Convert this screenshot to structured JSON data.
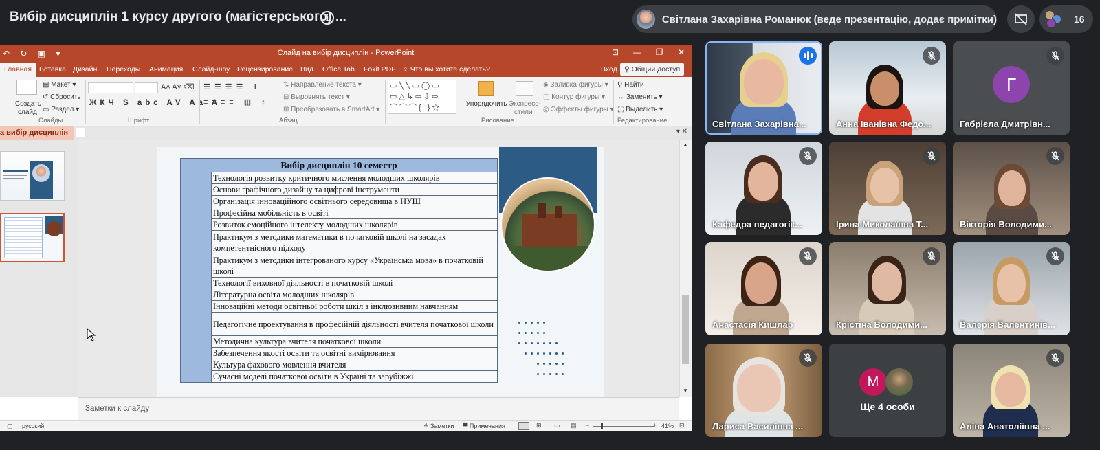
{
  "meeting": {
    "title": "Вибір дисциплін 1 курсу другого (магістерського) ...",
    "presenter_label": "Світлана Захарівна Романюк (веде презентацію, додає примітки)",
    "participant_count": "16"
  },
  "ppt": {
    "window_title": "Слайд на вибір дисциплін - PowerPoint",
    "tabs": [
      "Главная",
      "Вставка",
      "Дизайн",
      "Переходы",
      "Анимация",
      "Слайд-шоу",
      "Рецензирование",
      "Вид",
      "Office Tab",
      "Foxit PDF",
      "Что вы хотите сделать?"
    ],
    "login": "Вход",
    "share": "Общий доступ",
    "ribbon": {
      "create_slide": "Создать",
      "slide_label": "слайд",
      "layout": "Макет",
      "reset": "Сбросить",
      "section": "Раздел",
      "group_slides": "Слайды",
      "group_font": "Шрифт",
      "group_paragraph": "Абзац",
      "group_drawing": "Рисование",
      "group_editing": "Редактирование",
      "text_direction": "Направление текста",
      "align_text": "Выровнять текст",
      "smartart": "Преобразовать в SmartArt",
      "arrange": "Упорядочить",
      "quick_styles": "Экспресс-",
      "quick_styles_2": "стили",
      "shape_fill": "Заливка фигуры",
      "shape_outline": "Контур фигуры",
      "shape_effects": "Эффекты фигуры",
      "find": "Найти",
      "replace": "Заменить",
      "select": "Выделить"
    },
    "doc_tab": "а вибір дисциплін",
    "notes_placeholder": "Заметки к слайду",
    "status": {
      "language": "русский",
      "notes": "Заметки",
      "comments": "Примечания",
      "zoom": "41%"
    },
    "thumb1_name": "Світлана ... Романюк"
  },
  "slide": {
    "table_title": "Вибір дисциплін 10 семестр",
    "items": [
      "Технологія розвитку критичного мислення молодших школярів",
      "Основи графічного дизайну та цифрові інструменти",
      "Організація інноваційного освітнього середовища в НУШ",
      "Професійна мобільність в освіті",
      "Розвиток емоційного інтелекту молодших школярів",
      "Практикум з методики математики в початковій школі на засадах компетентнісного підходу",
      "Практикум з методики інтегрованого курсу «Українська мова» в початковій школі",
      "Технології виховної діяльності в початковій школі",
      "Літературна освіта молодших школярів",
      "Інноваційні методи освітньої роботи шкіл з інклюзивним навчанням",
      "Педагогічне проектування в професійній діяльності вчителя початкової школи",
      "Методична культура вчителя початкової школи",
      "Забезпечення якості освіти та освітні вимірювання",
      "Культура фахового мовлення вчителя",
      "Сучасні моделі початкової освіти в Україні та зарубіжжі"
    ]
  },
  "participants": [
    {
      "name": "Світлана Захарівна...",
      "speaking": true
    },
    {
      "name": "Анна Іванівна Федо...",
      "muted": true
    },
    {
      "name": "Габрієла Дмитрівн...",
      "muted": true,
      "initial": "Г"
    },
    {
      "name": "Кафедра педагогік...",
      "muted": true
    },
    {
      "name": "Ірина Миколаївна Т...",
      "muted": true
    },
    {
      "name": "Вікторія Володими...",
      "muted": true
    },
    {
      "name": "Анастасія Кишлар",
      "muted": true
    },
    {
      "name": "Крістіна Володими...",
      "muted": true
    },
    {
      "name": "Валерія Валентинів...",
      "muted": true
    },
    {
      "name": "Лариса Василівна ...",
      "muted": true
    },
    {
      "name": "Аліна Анатоліївна ...",
      "muted": true
    }
  ],
  "more": {
    "initial": "M",
    "label": "Ще 4 особи"
  },
  "colors": {
    "ppt_accent": "#b7472a",
    "meet_bg": "#202124",
    "tile_bg": "#3c4043",
    "active_outline": "#8ab4f8",
    "avatar_purple": "#8e44ad",
    "avatar_pink": "#c2185b"
  }
}
